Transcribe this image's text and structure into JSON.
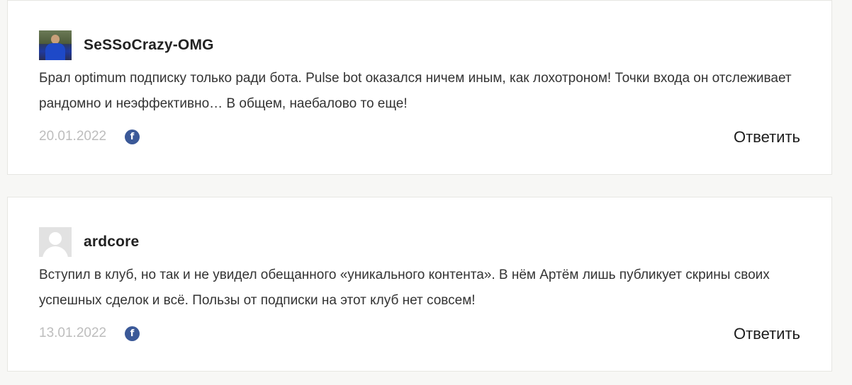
{
  "comments": [
    {
      "author": "SeSSoCrazy-OMG",
      "avatar": "user-photo",
      "text": "Брал optimum подписку только ради бота. Pulse bot оказался ничем иным, как лохотроном! Точки входа он отслеживает рандомно и неэффективно… В общем, наебалово то еще!",
      "date": "20.01.2022",
      "share_icon": "facebook-icon",
      "share_glyph": "f",
      "reply_label": "Ответить"
    },
    {
      "author": "ardcore",
      "avatar": "default-avatar",
      "text": "Вступил в клуб, но так и не увидел обещанного «уникального контента». В нём Артём лишь публикует скрины своих успешных сделок и всё. Пользы от подписки на этот клуб нет совсем!",
      "date": "13.01.2022",
      "share_icon": "facebook-icon",
      "share_glyph": "f",
      "reply_label": "Ответить"
    }
  ],
  "colors": {
    "background": "#f7f7f5",
    "card": "#ffffff",
    "date": "#bdbdbd",
    "facebook": "#3b5998"
  }
}
